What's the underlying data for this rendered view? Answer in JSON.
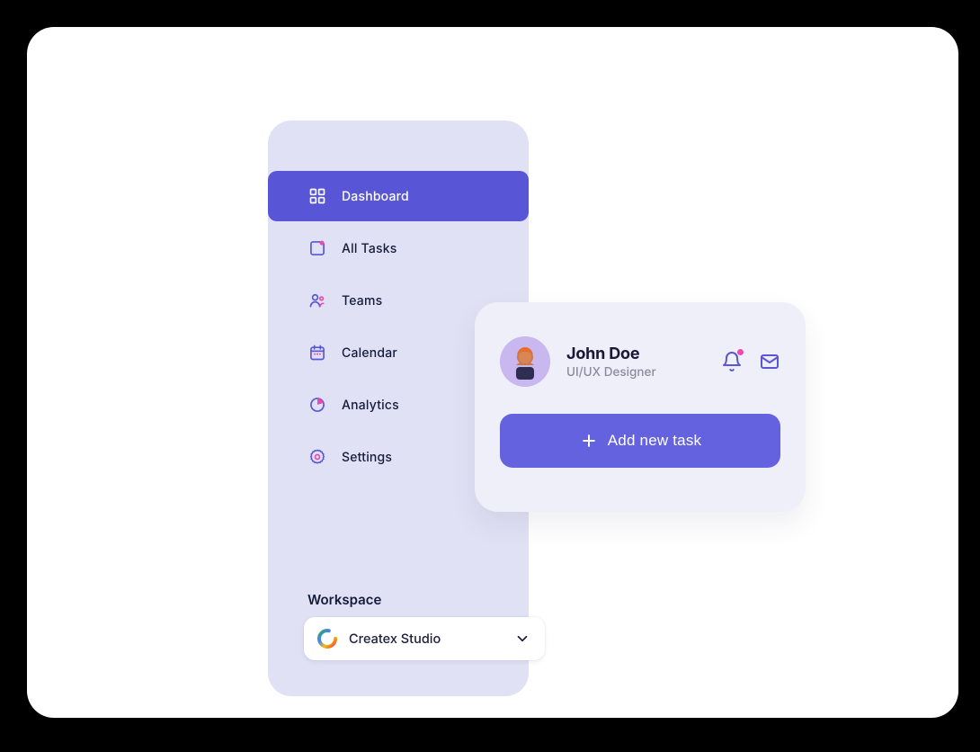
{
  "colors": {
    "primary": "#5856D6",
    "button": "#6462DE",
    "sidebar_bg": "#E1E1F5",
    "card_bg": "#EFEFF9",
    "accent_pink": "#E94BB0",
    "text": "#141C3A"
  },
  "sidebar": {
    "items": [
      {
        "label": "Dashboard",
        "icon": "dashboard-icon",
        "active": true
      },
      {
        "label": "All Tasks",
        "icon": "tasks-icon",
        "active": false
      },
      {
        "label": "Teams",
        "icon": "teams-icon",
        "active": false
      },
      {
        "label": "Calendar",
        "icon": "calendar-icon",
        "active": false
      },
      {
        "label": "Analytics",
        "icon": "analytics-icon",
        "active": false
      },
      {
        "label": "Settings",
        "icon": "settings-icon",
        "active": false
      }
    ],
    "workspace_label": "Workspace",
    "workspace_selected": "Createx Studio"
  },
  "user_card": {
    "name": "John Doe",
    "role": "UI/UX Designer",
    "actions": {
      "notifications": {
        "icon": "bell-icon",
        "has_indicator": true
      },
      "mail": {
        "icon": "mail-icon",
        "has_indicator": false
      }
    },
    "button_label": "Add new task",
    "button_icon": "plus-icon"
  }
}
